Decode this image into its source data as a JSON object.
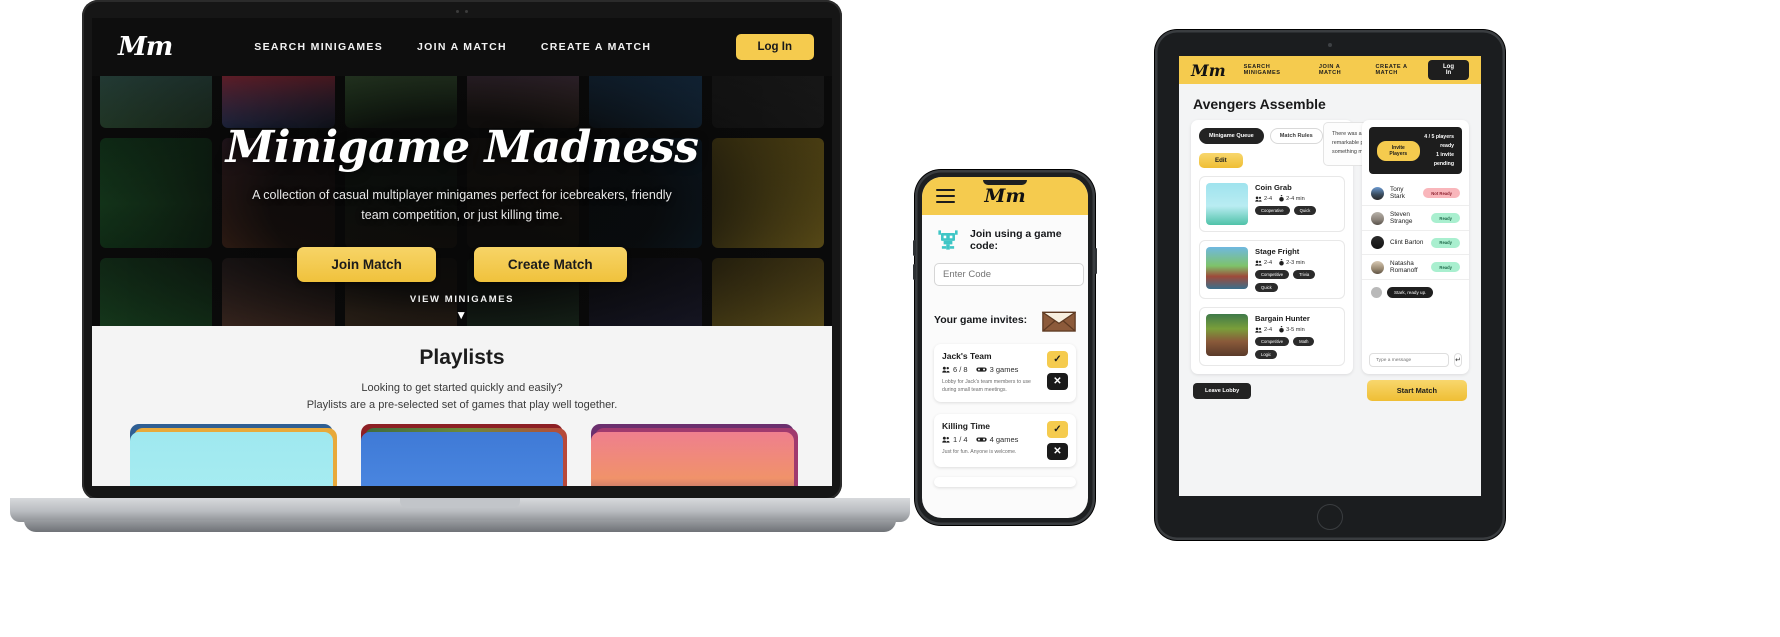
{
  "brand": {
    "logo": "Mm",
    "accent": "#f5cb4e",
    "dark": "#121212"
  },
  "laptop": {
    "nav": {
      "logo": "Mm",
      "links": [
        "SEARCH MINIGAMES",
        "JOIN A MATCH",
        "CREATE A MATCH"
      ],
      "login_label": "Log In"
    },
    "hero": {
      "title": "Minigame Madness",
      "subtitle": "A collection of casual multiplayer minigames perfect for icebreakers, friendly team competition, or just killing time.",
      "join_label": "Join Match",
      "create_label": "Create Match",
      "view_minigames": "VIEW MINIGAMES",
      "caret": "▼"
    },
    "playlists": {
      "title": "Playlists",
      "subtitle_line1": "Looking to get started quickly and easily?",
      "subtitle_line2": "Playlists are a pre-selected set of games that play well together."
    }
  },
  "phone": {
    "topbar": {
      "menu_icon": "hamburger-icon",
      "logo": "Mm"
    },
    "join": {
      "heading": "Join using a game code:",
      "monster_icon": "monster-icon",
      "input_placeholder": "Enter Code",
      "input_value": "",
      "submit_icon": "check-icon"
    },
    "invites": {
      "heading": "Your game invites:",
      "envelope_icon": "envelope-icon",
      "items": [
        {
          "name": "Jack's Team",
          "players": "6 / 8",
          "games": "3 games",
          "description": "Lobby for Jack's team members to use during small team meetings.",
          "accept_icon": "check-icon",
          "decline_icon": "x-icon"
        },
        {
          "name": "Killing Time",
          "players": "1 / 4",
          "games": "4 games",
          "description": "Just for fun.  Anyone is welcome.",
          "accept_icon": "check-icon",
          "decline_icon": "x-icon"
        }
      ]
    }
  },
  "tablet": {
    "nav": {
      "logo": "Mm",
      "links": [
        "SEARCH MINIGAMES",
        "JOIN A MATCH",
        "CREATE A MATCH"
      ],
      "login_label": "Log In"
    },
    "lobby_title": "Avengers Assemble",
    "lobby_description": "There was an idea to bring together a group of remarkable people to see if they could become something more.",
    "tabs": [
      {
        "label": "Minigame Queue",
        "active": true
      },
      {
        "label": "Match Rules",
        "active": false
      }
    ],
    "edit_label": "Edit",
    "games": [
      {
        "name": "Coin Grab",
        "players": "2-4",
        "duration": "2-4 min",
        "tags": [
          "Cooperative",
          "Quick"
        ]
      },
      {
        "name": "Stage Fright",
        "players": "2-4",
        "duration": "2-3 min",
        "tags": [
          "Competitive",
          "Trivia",
          "Quick"
        ]
      },
      {
        "name": "Bargain Hunter",
        "players": "2-4",
        "duration": "3-5 min",
        "tags": [
          "Competitive",
          "Math",
          "Logic"
        ]
      }
    ],
    "roster": {
      "invite_label": "Invite Players",
      "ready_count": "4 / 5 players ready",
      "pending": "1 invite pending",
      "players": [
        {
          "name": "Tony Stark",
          "status": "Not Ready",
          "ready": false
        },
        {
          "name": "Steven Strange",
          "status": "Ready",
          "ready": true
        },
        {
          "name": "Clint Barton",
          "status": "Ready",
          "ready": true
        },
        {
          "name": "Natasha Romanoff",
          "status": "Ready",
          "ready": true
        }
      ]
    },
    "chat": {
      "message": "Stark, ready up.",
      "input_placeholder": "Type a message",
      "input_value": "",
      "send_icon": "send-icon"
    },
    "leave_label": "Leave Lobby",
    "start_label": "Start Match"
  }
}
